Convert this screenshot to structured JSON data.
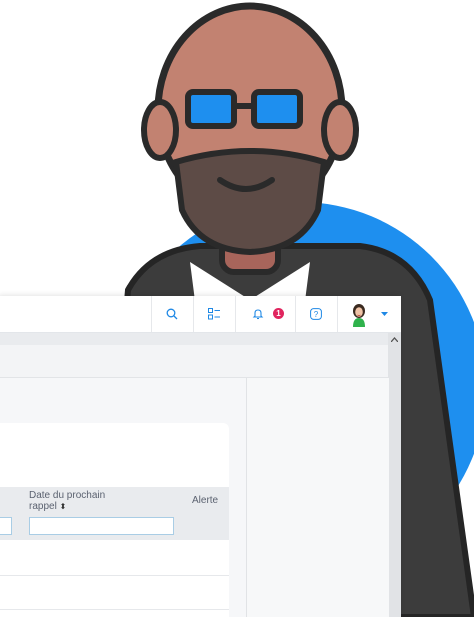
{
  "topbar": {
    "icons": [
      "search-icon",
      "tasks-icon",
      "bell-icon",
      "help-icon",
      "user-avatar",
      "chevron-down-icon"
    ],
    "notification_count": "1"
  },
  "table": {
    "columns": [
      {
        "label": "Date du prochain rappel",
        "line1": "Date du prochain",
        "line2": "rappel",
        "sort_icon": "⬍"
      },
      {
        "label": "Alerte"
      }
    ]
  },
  "colors": {
    "avatar_bg": "#1e8fef",
    "accent": "#1e88e5",
    "badge": "#e0245e"
  }
}
